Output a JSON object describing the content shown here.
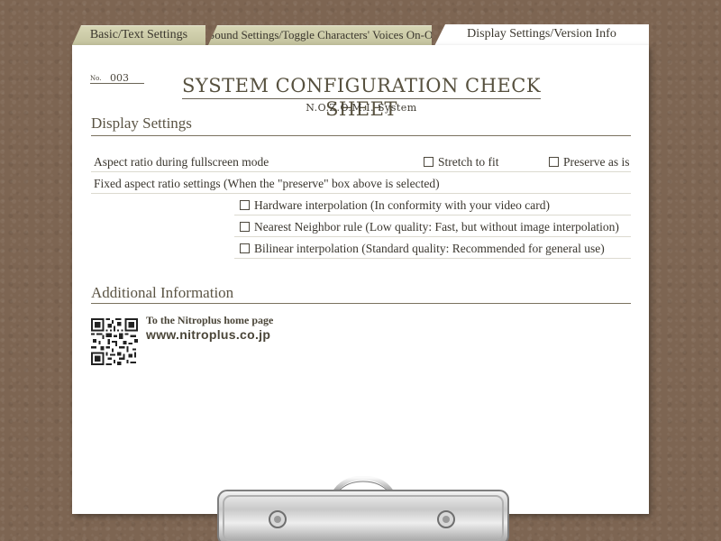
{
  "tabs": [
    {
      "label": "Basic/Text Settings",
      "active": false
    },
    {
      "label": "Sound Settings/Toggle Characters' Voices On-Off",
      "active": false
    },
    {
      "label": "Display Settings/Version Info",
      "active": true
    }
  ],
  "sheet": {
    "no_label": "No.",
    "no_value": "003",
    "title": "SYSTEM CONFIGURATION CHECK SHEET",
    "subtitle": "N.O.Z.O.M.I. System"
  },
  "display_settings": {
    "heading": "Display Settings",
    "aspect_ratio_label": "Aspect ratio during fullscreen mode",
    "aspect_options": [
      {
        "label": "Stretch to fit",
        "checked": false
      },
      {
        "label": "Preserve as is",
        "checked": false
      }
    ],
    "fixed_label": "Fixed aspect ratio settings (When the \"preserve\" box above is selected)",
    "interpolation_options": [
      {
        "label": "Hardware interpolation (In conformity with your video card)",
        "checked": false
      },
      {
        "label": "Nearest Neighbor rule (Low quality: Fast, but without image interpolation)",
        "checked": false
      },
      {
        "label": "Bilinear interpolation (Standard quality: Recommended for general use)",
        "checked": false
      }
    ]
  },
  "additional_info": {
    "heading": "Additional Information",
    "link_text": "To the Nitroplus home page",
    "url": "www.nitroplus.co.jp"
  },
  "colors": {
    "background": "#7d6552",
    "paper": "#ffffff",
    "tab_inactive": "#c9c8a4",
    "text": "#3a362e",
    "heading": "#5b5444"
  }
}
